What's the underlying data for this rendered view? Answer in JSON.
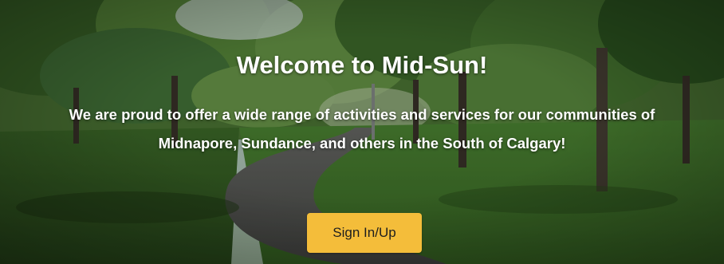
{
  "hero": {
    "title": "Welcome to Mid-Sun!",
    "tagline_line1": "We are proud to offer a wide range of activities and services for our communities of",
    "tagline_line2": "Midnapore, Sundance, and others in the South of Calgary!",
    "background": "park path with trees and grass",
    "button_label": "Sign In/Up",
    "button_color": "#f4bd3a",
    "text_color": "#ffffff"
  }
}
